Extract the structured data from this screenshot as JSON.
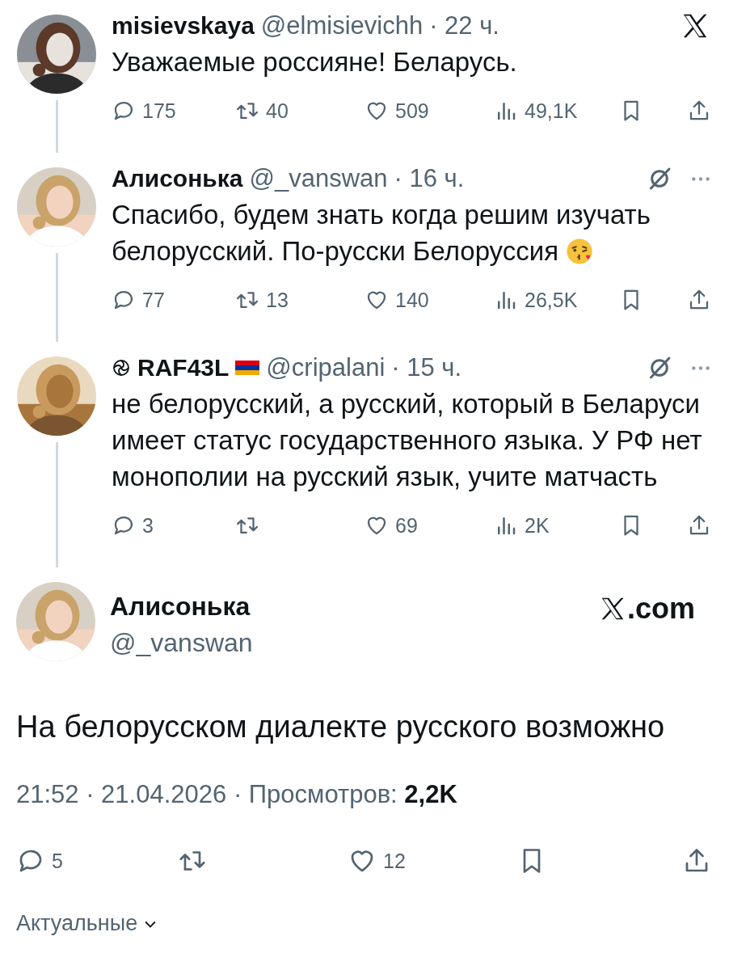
{
  "thread": [
    {
      "name": "misievskaya",
      "handle": "@elmisievichh",
      "time": "· 22 ч.",
      "kind": "original",
      "text": "Уважаемые россияне! Беларусь.",
      "stats": {
        "replies": "175",
        "reposts": "40",
        "likes": "509",
        "views": "49,1K"
      }
    },
    {
      "name": "Алисонька",
      "handle": "@_vanswan",
      "time": "· 16 ч.",
      "kind": "reply",
      "text": "Спасибо, будем знать когда решим изучать белорусский. По-русски Белоруссия",
      "emoji": true,
      "stats": {
        "replies": "77",
        "reposts": "13",
        "likes": "140",
        "views": "26,5K"
      }
    },
    {
      "name": "RAF43L",
      "handle": "@cripalani",
      "time": "· 15 ч.",
      "kind": "reply",
      "verified_icon": true,
      "flag": [
        {
          "color": "#d90012"
        },
        {
          "color": "#0033a0"
        },
        {
          "color": "#f2a800"
        }
      ],
      "text": "не белорусский, а русский, который в Беларуси имеет статус государственного языка. У РФ нет монополии на русский язык, учите матчасть",
      "stats": {
        "replies": "3",
        "likes": "69",
        "views": "2K"
      }
    }
  ],
  "main": {
    "name": "Алисонька",
    "handle": "@_vanswan",
    "brand": ".com",
    "text": "На белорусском диалекте русского возможно",
    "meta": "21:52 · 21.04.2026 · Просмотров:",
    "views": "2,2K",
    "stats": {
      "replies": "5",
      "likes": "12"
    }
  },
  "sort_label": "Актуальные"
}
